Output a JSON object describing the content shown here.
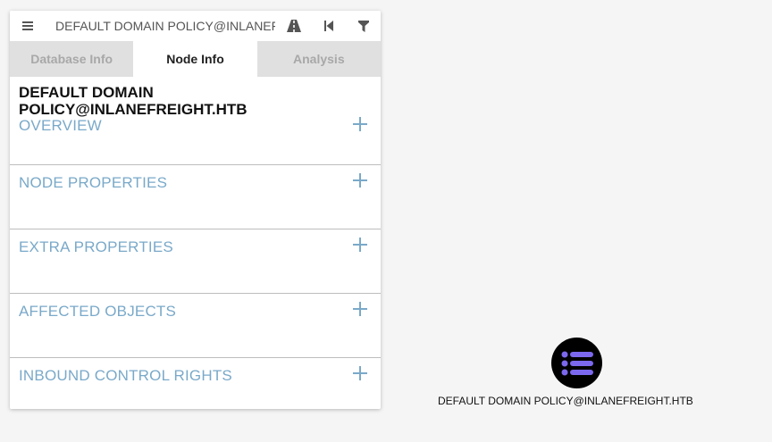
{
  "search": {
    "value": "DEFAULT DOMAIN POLICY@INLANEFREIGHT.HTB",
    "menu_icon": "menu-icon",
    "icons": [
      "pathfinding-road-icon",
      "back-icon",
      "filter-icon"
    ]
  },
  "tabs": [
    {
      "label": "Database Info",
      "active": false
    },
    {
      "label": "Node Info",
      "active": true
    },
    {
      "label": "Analysis",
      "active": false
    }
  ],
  "node_info": {
    "title": "DEFAULT DOMAIN POLICY@INLANEFREIGHT.HTB",
    "sections": [
      {
        "label": "OVERVIEW"
      },
      {
        "label": "NODE PROPERTIES"
      },
      {
        "label": "EXTRA PROPERTIES"
      },
      {
        "label": "AFFECTED OBJECTS"
      },
      {
        "label": "INBOUND CONTROL RIGHTS"
      }
    ]
  },
  "graph": {
    "node_label": "DEFAULT DOMAIN POLICY@INLANEFREIGHT.HTB",
    "node_icon": "list-icon",
    "node_color": "#000000",
    "icon_color": "#7b68ee"
  },
  "colors": {
    "section_label": "#7aa9c9",
    "tab_inactive_bg": "#e0e0e0",
    "background": "#f5f5f5"
  }
}
